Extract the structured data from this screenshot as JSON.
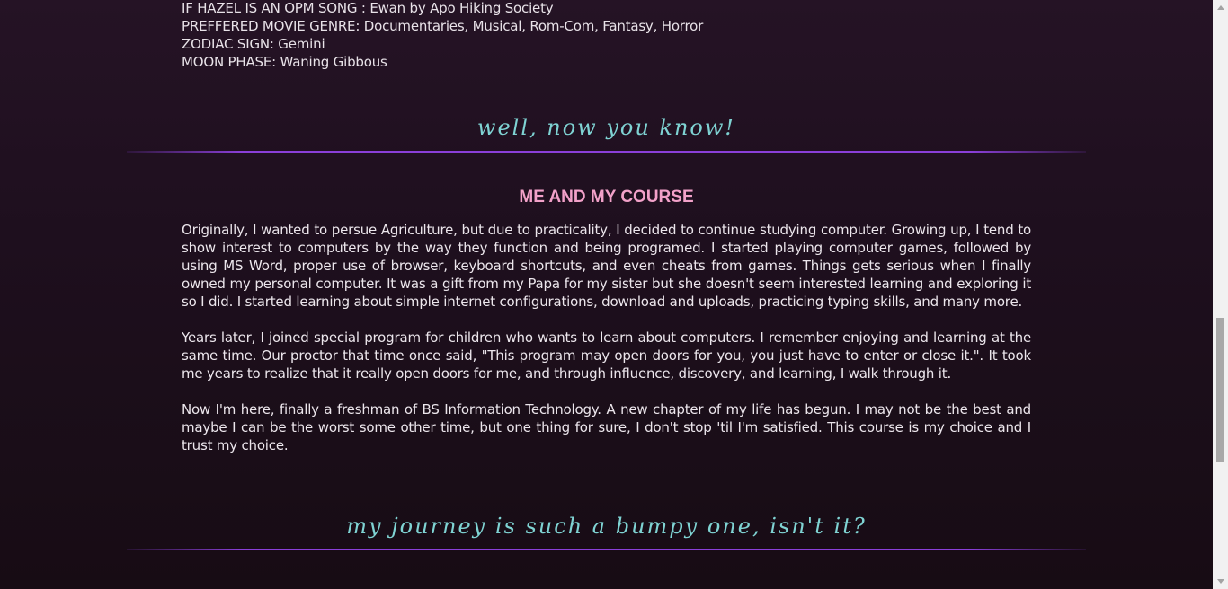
{
  "info": [
    "IF HAZEL IS AN OPM SONG : Ewan by Apo Hiking Society",
    "PREFFERED MOVIE GENRE: Documentaries, Musical, Rom-Com, Fantasy, Horror",
    "ZODIAC SIGN: Gemini",
    "MOON PHASE: Waning Gibbous"
  ],
  "tagline_1": "well, now you know!",
  "section": {
    "title": "ME AND MY COURSE",
    "paragraphs": [
      "Originally, I wanted to persue Agriculture, but due to practicality, I decided to continue studying computer. Growing up, I tend to show interest to computers by the way they function and being programed. I started playing computer games, followed by using MS Word, proper use of browser, keyboard shortcuts, and even cheats from games. Things gets serious when I finally owned my personal computer. It was a gift from my Papa for my sister but she doesn't seem interested learning and exploring it so I did. I started learning about simple internet configurations, download and uploads, practicing typing skills, and many more.",
      "Years later, I joined special program for children who wants to learn about computers. I remember enjoying and learning at the same time. Our proctor that time once said, \"This program may open doors for you, you just have to enter or close it.\". It took me years to realize that it really open doors for me, and through influence, discovery, and learning, I walk through it.",
      "Now I'm here, finally a freshman of BS Information Technology. A new chapter of my life has begun. I may not be the best and maybe I can be the worst some other time, but one thing for sure, I don't stop 'til I'm satisfied. This course is my choice and I trust my choice."
    ]
  },
  "tagline_2": "my journey is such a bumpy one, isn't it?",
  "colors": {
    "accent_pink": "#f2a1c9",
    "accent_teal": "#7fd3d3",
    "divider_purple": "#8a3fd8"
  }
}
